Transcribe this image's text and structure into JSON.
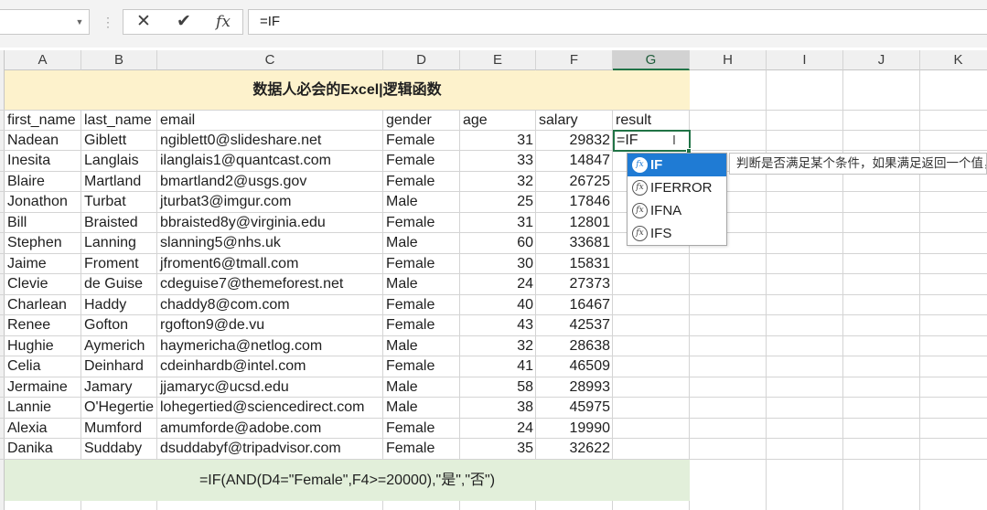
{
  "formula_bar": {
    "name_box": "",
    "separator": "⋮",
    "cancel_icon": "✕",
    "enter_icon": "✔",
    "fx_label": "fx",
    "formula": "=IF"
  },
  "columns": [
    "A",
    "B",
    "C",
    "D",
    "E",
    "F",
    "G",
    "H",
    "I",
    "J",
    "K"
  ],
  "selected_column": "G",
  "title": "数据人必会的Excel|逻辑函数",
  "headers": [
    "first_name",
    "last_name",
    "email",
    "gender",
    "age",
    "salary",
    "result"
  ],
  "rows": [
    [
      "Nadean",
      "Giblett",
      "ngiblett0@slideshare.net",
      "Female",
      "31",
      "29832"
    ],
    [
      "Inesita",
      "Langlais",
      "ilanglais1@quantcast.com",
      "Female",
      "33",
      "14847"
    ],
    [
      "Blaire",
      "Martland",
      "bmartland2@usgs.gov",
      "Female",
      "32",
      "26725"
    ],
    [
      "Jonathon",
      "Turbat",
      "jturbat3@imgur.com",
      "Male",
      "25",
      "17846"
    ],
    [
      "Bill",
      "Braisted",
      "bbraisted8y@virginia.edu",
      "Female",
      "31",
      "12801"
    ],
    [
      "Stephen",
      "Lanning",
      "slanning5@nhs.uk",
      "Male",
      "60",
      "33681"
    ],
    [
      "Jaime",
      "Froment",
      "jfroment6@tmall.com",
      "Female",
      "30",
      "15831"
    ],
    [
      "Clevie",
      "de Guise",
      "cdeguise7@themeforest.net",
      "Male",
      "24",
      "27373"
    ],
    [
      "Charlean",
      "Haddy",
      "chaddy8@com.com",
      "Female",
      "40",
      "16467"
    ],
    [
      "Renee",
      "Gofton",
      "rgofton9@de.vu",
      "Female",
      "43",
      "42537"
    ],
    [
      "Hughie",
      "Aymerich",
      "haymericha@netlog.com",
      "Male",
      "32",
      "28638"
    ],
    [
      "Celia",
      "Deinhard",
      "cdeinhardb@intel.com",
      "Female",
      "41",
      "46509"
    ],
    [
      "Jermaine",
      "Jamary",
      "jjamaryc@ucsd.edu",
      "Male",
      "58",
      "28993"
    ],
    [
      "Lannie",
      "O'Hegertie",
      "lohegertied@sciencedirect.com",
      "Male",
      "38",
      "45975"
    ],
    [
      "Alexia",
      "Mumford",
      "amumforde@adobe.com",
      "Female",
      "24",
      "19990"
    ],
    [
      "Danika",
      "Suddaby",
      "dsuddabyf@tripadvisor.com",
      "Female",
      "35",
      "32622"
    ]
  ],
  "active_cell_value": "=IF",
  "autocomplete": {
    "items": [
      "IF",
      "IFERROR",
      "IFNA",
      "IFS"
    ],
    "icon_label": "fx",
    "tooltip": "判断是否满足某个条件，如果满足返回一个值，如果不满足则返回另一个值。"
  },
  "bottom_formula": "=IF(AND(D4=\"Female\",F4>=20000),\"是\",\"否\")",
  "colors": {
    "accent": "#217346",
    "title_band": "#fdf2cc",
    "formula_band": "#e2efda",
    "autocomplete_selected": "#1f7bd4"
  }
}
